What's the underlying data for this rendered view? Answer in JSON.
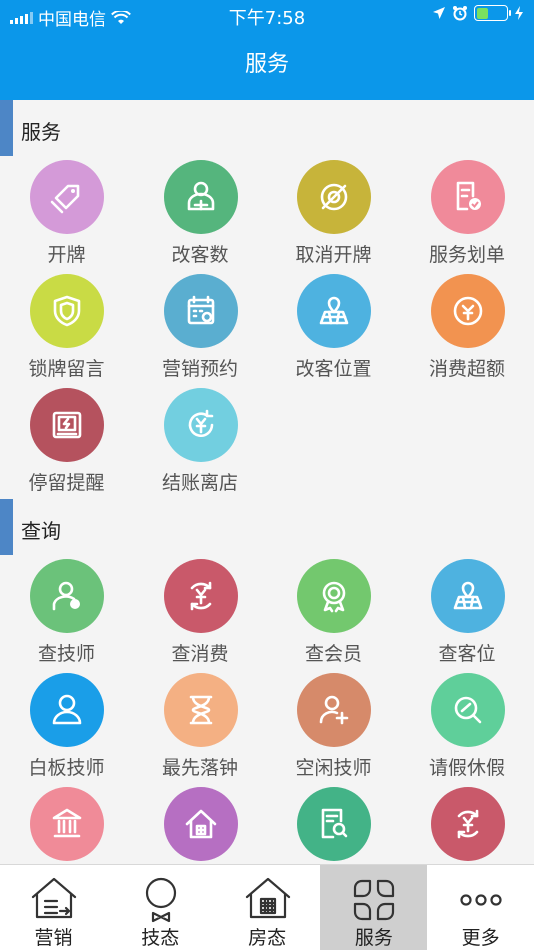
{
  "status_bar": {
    "carrier": "中国电信",
    "time": "下午7:58"
  },
  "header": {
    "title": "服务"
  },
  "sections": [
    {
      "title": "服务",
      "items": [
        {
          "label": "开牌",
          "icon": "tag-icon",
          "color": "#d49ad8"
        },
        {
          "label": "改客数",
          "icon": "user-count-icon",
          "color": "#55b57d"
        },
        {
          "label": "取消开牌",
          "icon": "cancel-target-icon",
          "color": "#c7b43a"
        },
        {
          "label": "服务划单",
          "icon": "document-check-icon",
          "color": "#f08a9a"
        },
        {
          "label": "锁牌留言",
          "icon": "shield-icon",
          "color": "#c9db45"
        },
        {
          "label": "营销预约",
          "icon": "calendar-clock-icon",
          "color": "#5aaed0"
        },
        {
          "label": "改客位置",
          "icon": "map-pin-icon",
          "color": "#4eb2e0"
        },
        {
          "label": "消费超额",
          "icon": "yuan-bowl-icon",
          "color": "#f29350"
        },
        {
          "label": "停留提醒",
          "icon": "alarm-box-icon",
          "color": "#b5525e"
        },
        {
          "label": "结账离店",
          "icon": "yuan-refresh-icon",
          "color": "#72cfe0"
        }
      ]
    },
    {
      "title": "查询",
      "items": [
        {
          "label": "查技师",
          "icon": "technician-icon",
          "color": "#6bc27a"
        },
        {
          "label": "查消费",
          "icon": "yuan-cycle-icon",
          "color": "#c9596a"
        },
        {
          "label": "查会员",
          "icon": "member-badge-icon",
          "color": "#73c86e"
        },
        {
          "label": "查客位",
          "icon": "map-pin-icon",
          "color": "#4eb2e0"
        },
        {
          "label": "白板技师",
          "icon": "person-outline-icon",
          "color": "#1a9ee8"
        },
        {
          "label": "最先落钟",
          "icon": "hourglass-icon",
          "color": "#f4b083"
        },
        {
          "label": "空闲技师",
          "icon": "person-add-icon",
          "color": "#d68a6a"
        },
        {
          "label": "请假休假",
          "icon": "search-leaf-icon",
          "color": "#5fcf9a"
        },
        {
          "label": "",
          "icon": "bank-icon",
          "color": "#f08b98"
        },
        {
          "label": "",
          "icon": "house-grid-icon",
          "color": "#b66fc2"
        },
        {
          "label": "",
          "icon": "doc-search-icon",
          "color": "#43b387"
        },
        {
          "label": "",
          "icon": "yuan-cycle-icon",
          "color": "#c9596a"
        }
      ]
    }
  ],
  "tabbar": [
    {
      "label": "营销",
      "icon": "house-list-icon",
      "active": false
    },
    {
      "label": "技态",
      "icon": "bowtie-person-icon",
      "active": false
    },
    {
      "label": "房态",
      "icon": "house-grid-icon",
      "active": false
    },
    {
      "label": "服务",
      "icon": "grid-knot-icon",
      "active": true
    },
    {
      "label": "更多",
      "icon": "more-dots-icon",
      "active": false
    }
  ]
}
